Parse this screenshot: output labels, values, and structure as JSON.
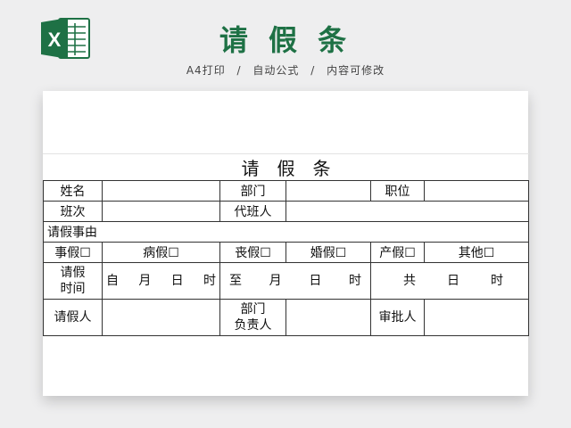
{
  "header": {
    "title": "请 假 条",
    "subtitle_parts": [
      "A4打印",
      "自动公式",
      "内容可修改"
    ],
    "subtitle_sep": "/",
    "logo_letter": "X",
    "accent_color": "#1e7145"
  },
  "form": {
    "title": "请　假　条",
    "name_label": "姓名",
    "dept_label": "部门",
    "position_label": "职位",
    "shift_label": "班次",
    "substitute_label": "代班人",
    "reason_label": "请假事由",
    "leave_types": [
      "事假☐",
      "病假☐",
      "丧假☐",
      "婚假☐",
      "产假☐",
      "其他☐"
    ],
    "period_label_1": "请假",
    "period_label_2": "时间",
    "from_text": "自　月　日　时",
    "to_text": "至　月　日　时",
    "total_text": "共　日　时",
    "applicant_label": "请假人",
    "dept_head_label_1": "部门",
    "dept_head_label_2": "负责人",
    "approver_label": "审批人"
  }
}
